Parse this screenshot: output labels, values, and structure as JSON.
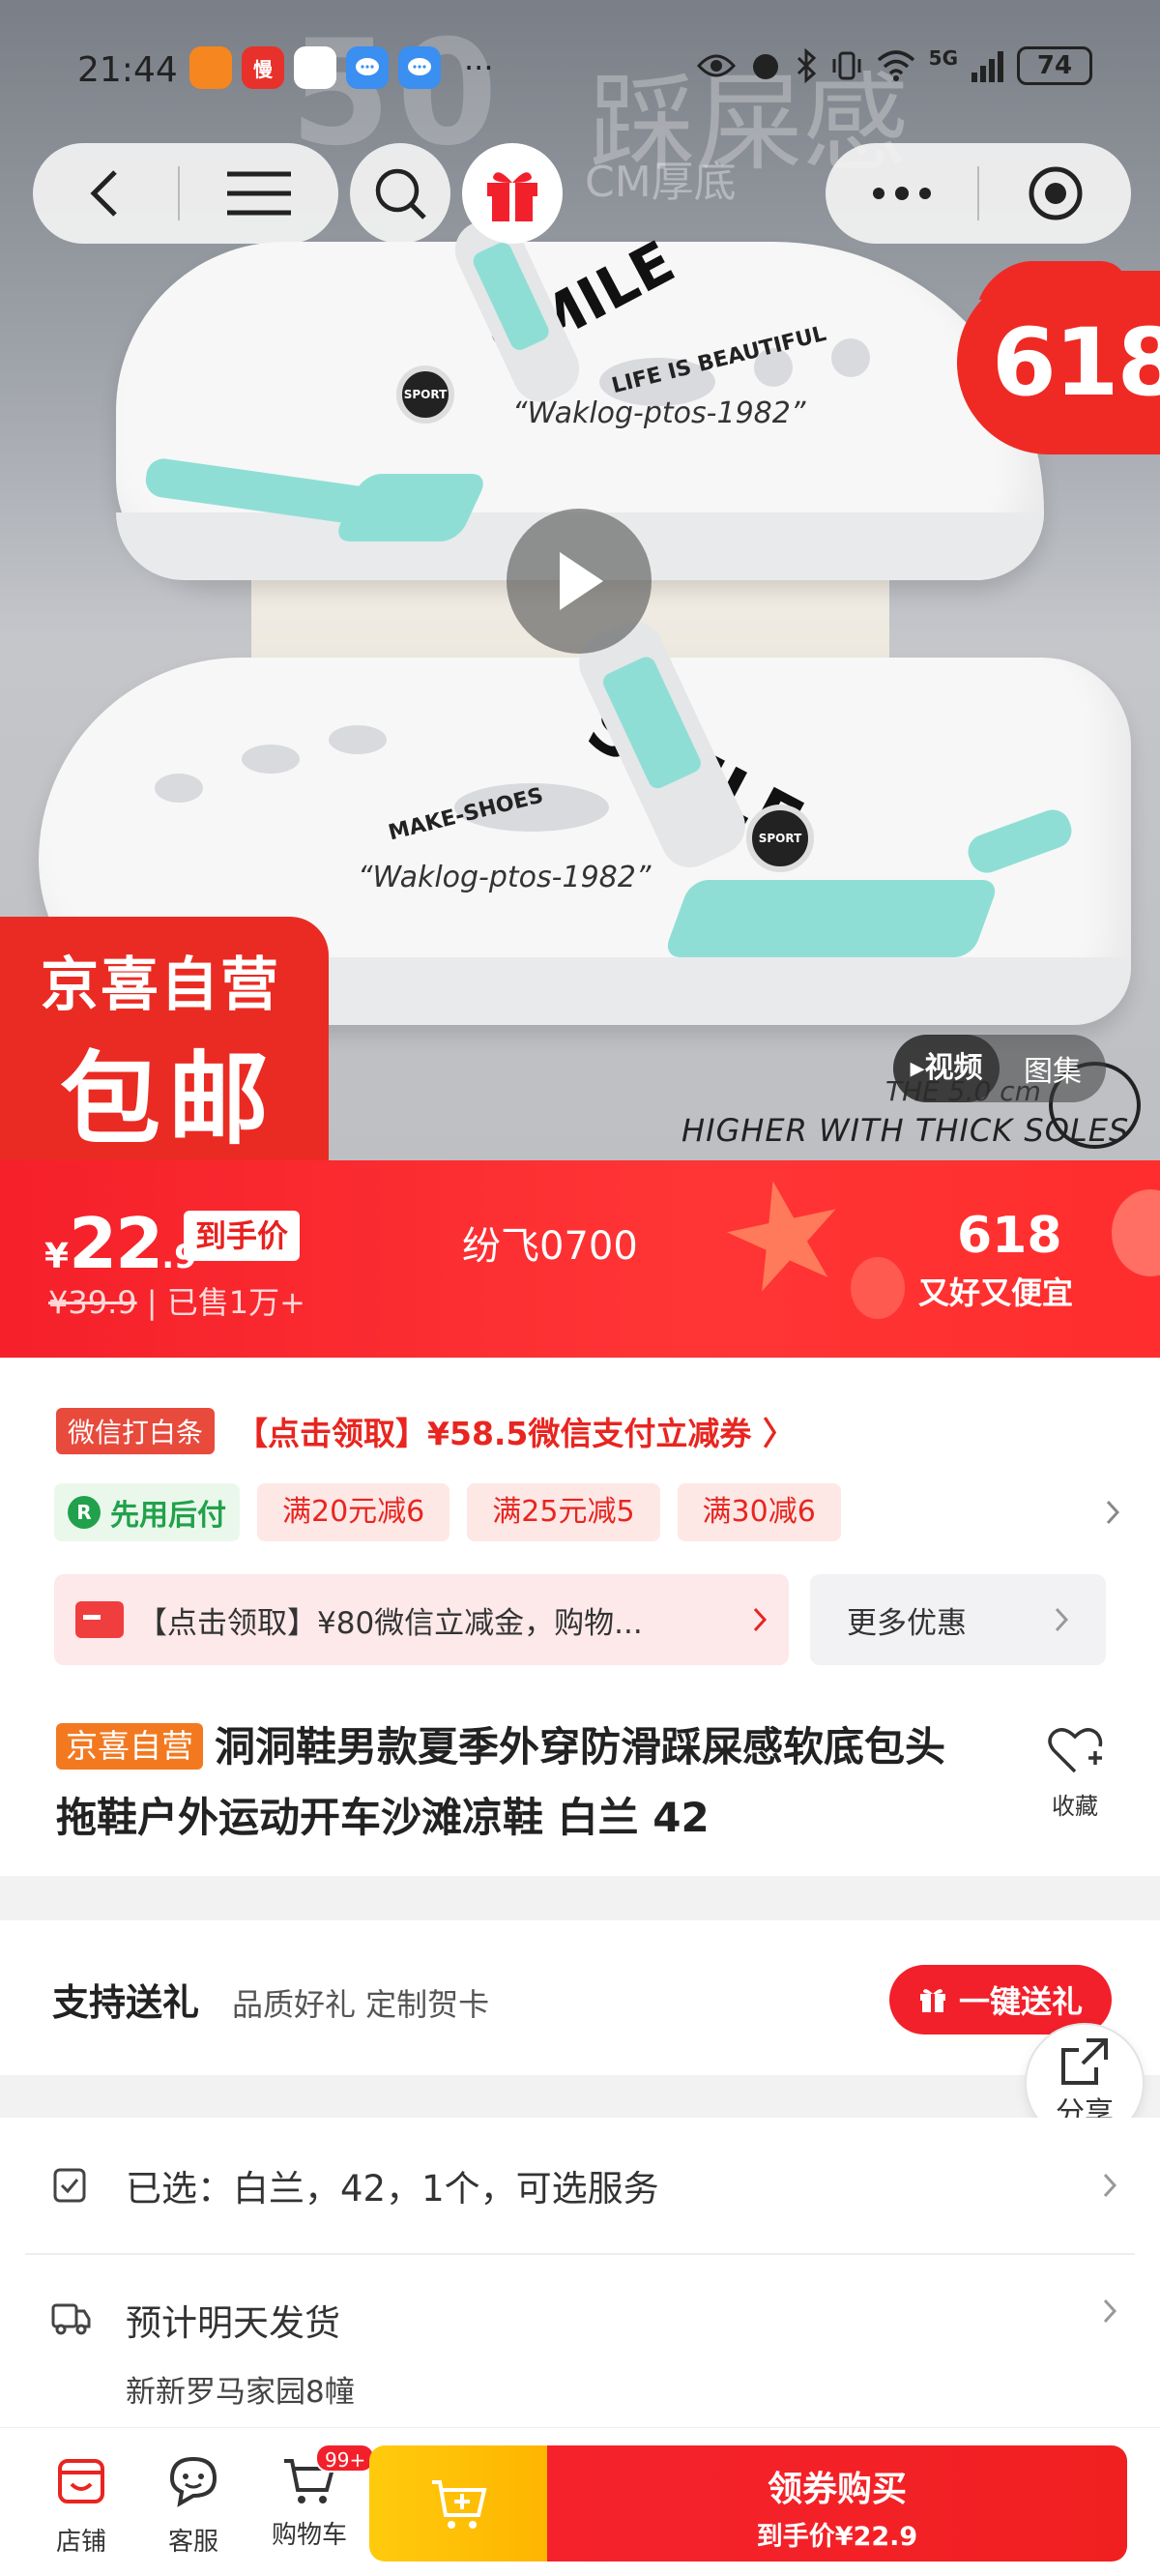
{
  "status_bar": {
    "time": "21:44",
    "app_icons": [
      "拼多多",
      "慢",
      "小鹅",
      "消息",
      "消息"
    ],
    "more_dots": "···",
    "network": "5G",
    "battery": "74"
  },
  "hero": {
    "background_text_number": "50",
    "background_text_word": "踩屎感",
    "background_text_sub": "CM厚底",
    "badge_618": "618",
    "promo_line1": "京喜自营",
    "promo_line2": "包邮",
    "brand_mark": "SMILE",
    "slogan_small": "LIFE IS BEAUTIFUL",
    "slogan_small2": "MAKE-SHOES",
    "slogan_model": "“Waklog-ptos-1982”",
    "rivet_text": "SPORT",
    "thickness_text": "THE 5.0 cm",
    "higher_text": "HIGHER WITH THICK SOLES",
    "media_tabs": [
      "▸视频",
      "图集"
    ]
  },
  "price": {
    "currency": "¥",
    "integer": "22",
    "decimal": ".9",
    "final_label": "到手价",
    "original": "¥39.9",
    "separator": " | ",
    "sold": "已售1万+",
    "seller": "纷飞0700",
    "sale_title": "618",
    "sale_slogan": "又好又便宜"
  },
  "coupons": {
    "wx_tag": "微信打白条",
    "wx_text": "【点击领取】¥58.5微信支付立减券 〉",
    "pay_later": "先用后付",
    "pay_later_icon": "R",
    "chips": [
      "满20元减6",
      "满25元减5",
      "满30减6"
    ],
    "banner_text": "【点击领取】¥80微信立减金，购物...",
    "more_deals": "更多优惠"
  },
  "product": {
    "tag": "京喜自营",
    "title": "洞洞鞋男款夏季外穿防滑踩屎感软底包头拖鞋户外运动开车沙滩凉鞋 白兰 42",
    "favorite_label": "收藏"
  },
  "gift": {
    "title": "支持送礼",
    "subtitle": "品质好礼 定制贺卡",
    "button": "一键送礼",
    "share_label": "分享"
  },
  "spec": {
    "selected": "已选：白兰，42，1个，可选服务",
    "shipping_title": "预计明天发货",
    "shipping_address": "新新罗马家园8幢"
  },
  "bottom_bar": {
    "shop": "店铺",
    "service": "客服",
    "cart": "购物车",
    "cart_badge": "99+",
    "buy_line1": "领券购买",
    "buy_line2": "到手价¥22.9"
  },
  "colors": {
    "brand_red": "#f5202a",
    "jx_orange": "#f37920",
    "add_cart_yellow": "#ffc20e",
    "pay_later_green": "#21a14b"
  }
}
